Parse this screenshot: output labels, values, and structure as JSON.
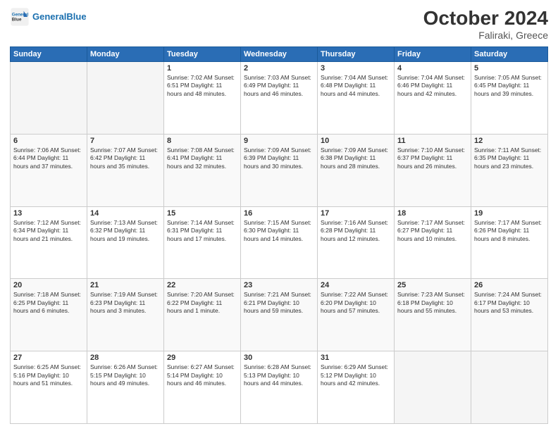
{
  "header": {
    "logo_general": "General",
    "logo_blue": "Blue",
    "month": "October 2024",
    "location": "Faliraki, Greece"
  },
  "days_of_week": [
    "Sunday",
    "Monday",
    "Tuesday",
    "Wednesday",
    "Thursday",
    "Friday",
    "Saturday"
  ],
  "weeks": [
    [
      {
        "day": "",
        "info": ""
      },
      {
        "day": "",
        "info": ""
      },
      {
        "day": "1",
        "info": "Sunrise: 7:02 AM\nSunset: 6:51 PM\nDaylight: 11 hours and 48 minutes."
      },
      {
        "day": "2",
        "info": "Sunrise: 7:03 AM\nSunset: 6:49 PM\nDaylight: 11 hours and 46 minutes."
      },
      {
        "day": "3",
        "info": "Sunrise: 7:04 AM\nSunset: 6:48 PM\nDaylight: 11 hours and 44 minutes."
      },
      {
        "day": "4",
        "info": "Sunrise: 7:04 AM\nSunset: 6:46 PM\nDaylight: 11 hours and 42 minutes."
      },
      {
        "day": "5",
        "info": "Sunrise: 7:05 AM\nSunset: 6:45 PM\nDaylight: 11 hours and 39 minutes."
      }
    ],
    [
      {
        "day": "6",
        "info": "Sunrise: 7:06 AM\nSunset: 6:44 PM\nDaylight: 11 hours and 37 minutes."
      },
      {
        "day": "7",
        "info": "Sunrise: 7:07 AM\nSunset: 6:42 PM\nDaylight: 11 hours and 35 minutes."
      },
      {
        "day": "8",
        "info": "Sunrise: 7:08 AM\nSunset: 6:41 PM\nDaylight: 11 hours and 32 minutes."
      },
      {
        "day": "9",
        "info": "Sunrise: 7:09 AM\nSunset: 6:39 PM\nDaylight: 11 hours and 30 minutes."
      },
      {
        "day": "10",
        "info": "Sunrise: 7:09 AM\nSunset: 6:38 PM\nDaylight: 11 hours and 28 minutes."
      },
      {
        "day": "11",
        "info": "Sunrise: 7:10 AM\nSunset: 6:37 PM\nDaylight: 11 hours and 26 minutes."
      },
      {
        "day": "12",
        "info": "Sunrise: 7:11 AM\nSunset: 6:35 PM\nDaylight: 11 hours and 23 minutes."
      }
    ],
    [
      {
        "day": "13",
        "info": "Sunrise: 7:12 AM\nSunset: 6:34 PM\nDaylight: 11 hours and 21 minutes."
      },
      {
        "day": "14",
        "info": "Sunrise: 7:13 AM\nSunset: 6:32 PM\nDaylight: 11 hours and 19 minutes."
      },
      {
        "day": "15",
        "info": "Sunrise: 7:14 AM\nSunset: 6:31 PM\nDaylight: 11 hours and 17 minutes."
      },
      {
        "day": "16",
        "info": "Sunrise: 7:15 AM\nSunset: 6:30 PM\nDaylight: 11 hours and 14 minutes."
      },
      {
        "day": "17",
        "info": "Sunrise: 7:16 AM\nSunset: 6:28 PM\nDaylight: 11 hours and 12 minutes."
      },
      {
        "day": "18",
        "info": "Sunrise: 7:17 AM\nSunset: 6:27 PM\nDaylight: 11 hours and 10 minutes."
      },
      {
        "day": "19",
        "info": "Sunrise: 7:17 AM\nSunset: 6:26 PM\nDaylight: 11 hours and 8 minutes."
      }
    ],
    [
      {
        "day": "20",
        "info": "Sunrise: 7:18 AM\nSunset: 6:25 PM\nDaylight: 11 hours and 6 minutes."
      },
      {
        "day": "21",
        "info": "Sunrise: 7:19 AM\nSunset: 6:23 PM\nDaylight: 11 hours and 3 minutes."
      },
      {
        "day": "22",
        "info": "Sunrise: 7:20 AM\nSunset: 6:22 PM\nDaylight: 11 hours and 1 minute."
      },
      {
        "day": "23",
        "info": "Sunrise: 7:21 AM\nSunset: 6:21 PM\nDaylight: 10 hours and 59 minutes."
      },
      {
        "day": "24",
        "info": "Sunrise: 7:22 AM\nSunset: 6:20 PM\nDaylight: 10 hours and 57 minutes."
      },
      {
        "day": "25",
        "info": "Sunrise: 7:23 AM\nSunset: 6:18 PM\nDaylight: 10 hours and 55 minutes."
      },
      {
        "day": "26",
        "info": "Sunrise: 7:24 AM\nSunset: 6:17 PM\nDaylight: 10 hours and 53 minutes."
      }
    ],
    [
      {
        "day": "27",
        "info": "Sunrise: 6:25 AM\nSunset: 5:16 PM\nDaylight: 10 hours and 51 minutes."
      },
      {
        "day": "28",
        "info": "Sunrise: 6:26 AM\nSunset: 5:15 PM\nDaylight: 10 hours and 49 minutes."
      },
      {
        "day": "29",
        "info": "Sunrise: 6:27 AM\nSunset: 5:14 PM\nDaylight: 10 hours and 46 minutes."
      },
      {
        "day": "30",
        "info": "Sunrise: 6:28 AM\nSunset: 5:13 PM\nDaylight: 10 hours and 44 minutes."
      },
      {
        "day": "31",
        "info": "Sunrise: 6:29 AM\nSunset: 5:12 PM\nDaylight: 10 hours and 42 minutes."
      },
      {
        "day": "",
        "info": ""
      },
      {
        "day": "",
        "info": ""
      }
    ]
  ]
}
